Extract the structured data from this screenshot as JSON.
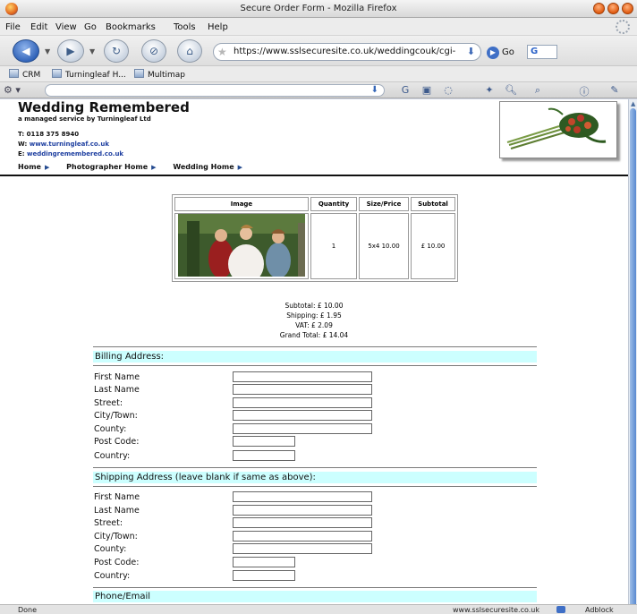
{
  "window": {
    "title": "Secure Order Form - Mozilla Firefox"
  },
  "menu": [
    "File",
    "Edit",
    "View",
    "Go",
    "Bookmarks",
    "Tools",
    "Help"
  ],
  "navigation": {
    "url": "https://www.sslsecuresite.co.uk/weddingcouk/cgi-bin/tur",
    "go_label": "Go",
    "search_engine": "G"
  },
  "bookmarks": [
    "CRM",
    "Turningleaf H...",
    "Multimap"
  ],
  "site": {
    "title": "Wedding Remembered",
    "tagline": "a managed service by Turningleaf Ltd",
    "phone_label": "T:",
    "phone": "0118 375 8940",
    "web_label": "W:",
    "web": "www.turningleaf.co.uk",
    "email_label": "E:",
    "email": "weddingremembered.co.uk",
    "nav": [
      "Home",
      "Photographer Home",
      "Wedding Home"
    ]
  },
  "order_table": {
    "headers": [
      "Image",
      "Quantity",
      "Size/Price",
      "Subtotal"
    ],
    "rows": [
      {
        "quantity": "1",
        "size_price": "5x4 10.00",
        "subtotal": "£ 10.00"
      }
    ]
  },
  "totals": {
    "subtotal": "Subtotal: £ 10.00",
    "shipping": "Shipping: £ 1.95",
    "vat": "VAT: £ 2.09",
    "grand_total": "Grand Total: £ 14.04"
  },
  "billing": {
    "heading": "Billing Address:",
    "fields": [
      "First Name",
      "Last Name",
      "Street:",
      "City/Town:",
      "County:",
      "Post Code:",
      "Country:"
    ]
  },
  "shipping": {
    "heading": "Shipping Address (leave blank if same as above):",
    "fields": [
      "First Name",
      "Last Name",
      "Street:",
      "City/Town:",
      "County:",
      "Post Code:",
      "Country:"
    ]
  },
  "phone_email": {
    "heading": "Phone/Email"
  },
  "status": {
    "text": "Done",
    "site": "www.sslsecuresite.co.uk",
    "adblock": "Adblock"
  },
  "colors": {
    "section_bg": "#ccffff",
    "link": "#1e3fa0"
  }
}
